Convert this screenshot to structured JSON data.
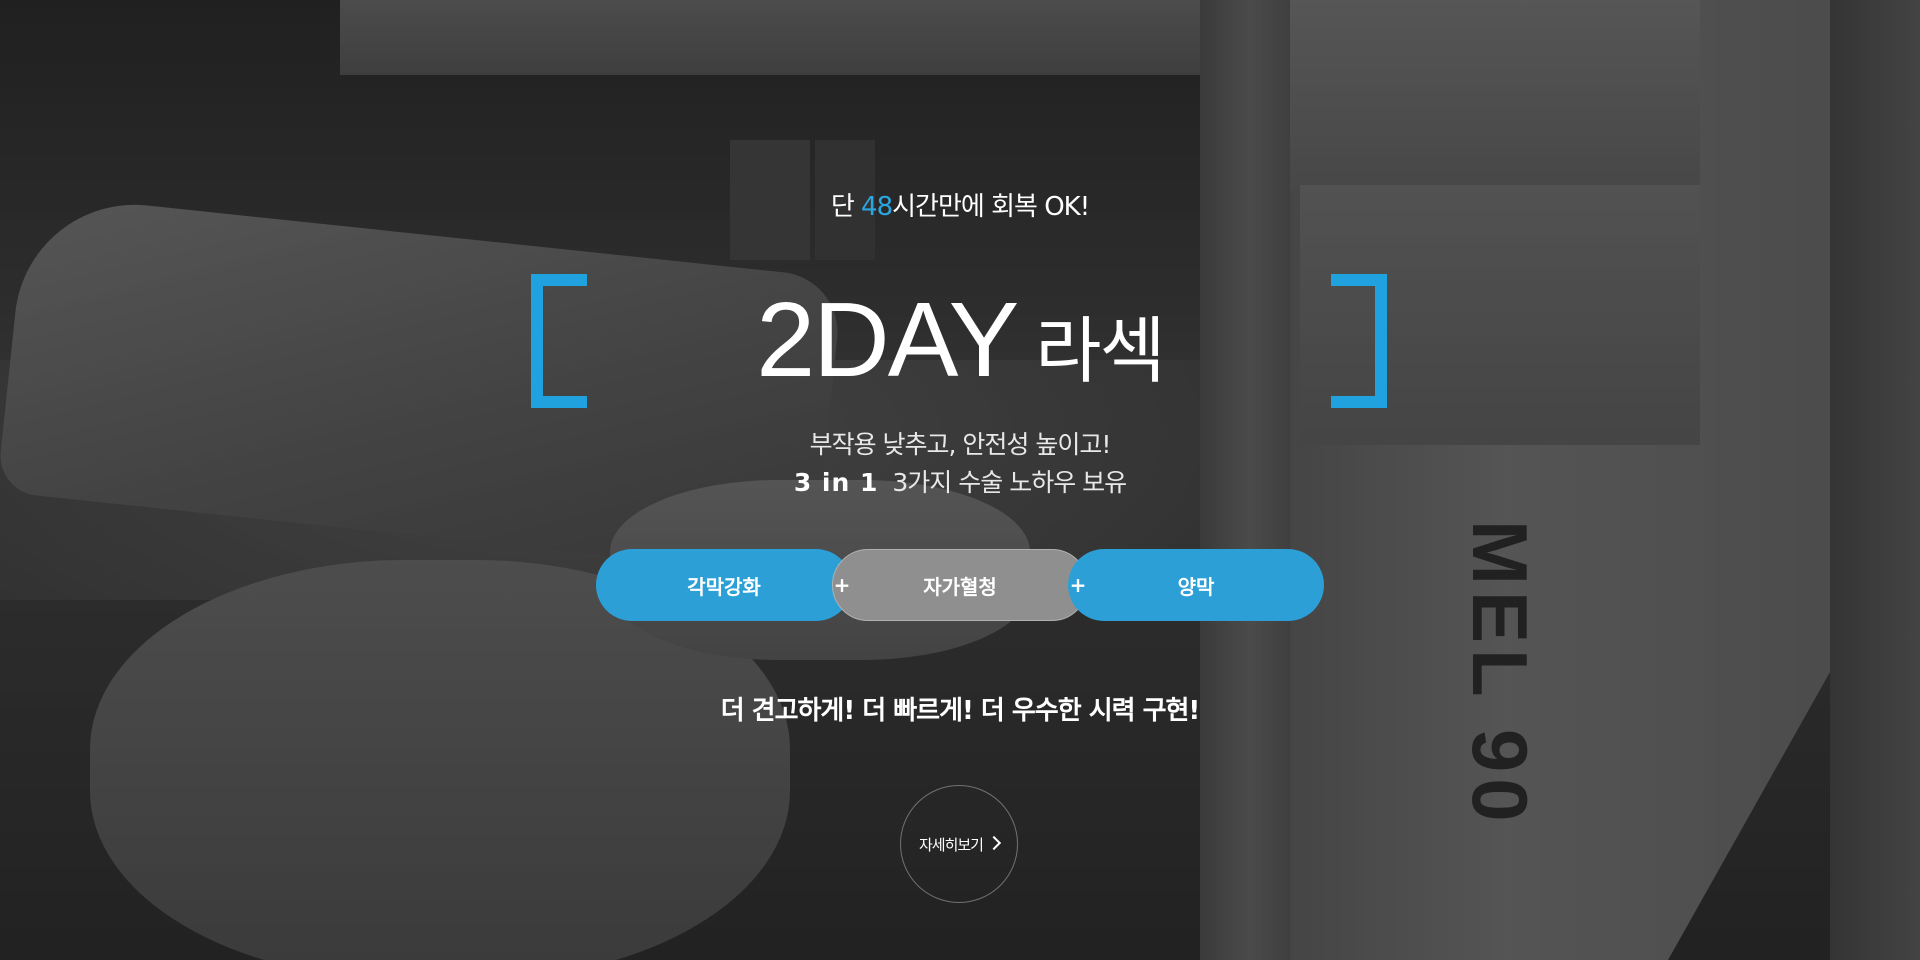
{
  "background": {
    "machine_label": "MEL 90"
  },
  "hero": {
    "tagline_prefix": "단 ",
    "tagline_accent": "48",
    "tagline_suffix": "시간만에 회복 OK!",
    "title_bold": "2DAY",
    "title_light": "라섹",
    "subtitle_line1": "부작용 낮추고, 안전성 높이고!",
    "subtitle_strong": "3 in 1",
    "subtitle_line2": "3가지 수술 노하우 보유",
    "pills": [
      {
        "label": "각막강화"
      },
      {
        "label": "자가혈청"
      },
      {
        "label": "양막"
      }
    ],
    "plus_symbol": "+",
    "slogan": "더 견고하게! 더 빠르게! 더 우수한 시력 구현!",
    "more_label": "자세히보기"
  },
  "colors": {
    "accent": "#1fa2dd",
    "pill_blue": "#2b9fd6",
    "pill_gray": "#8f8f8f"
  },
  "icons": {
    "more": "chevron-right-icon",
    "bracket": "bracket-icon"
  }
}
